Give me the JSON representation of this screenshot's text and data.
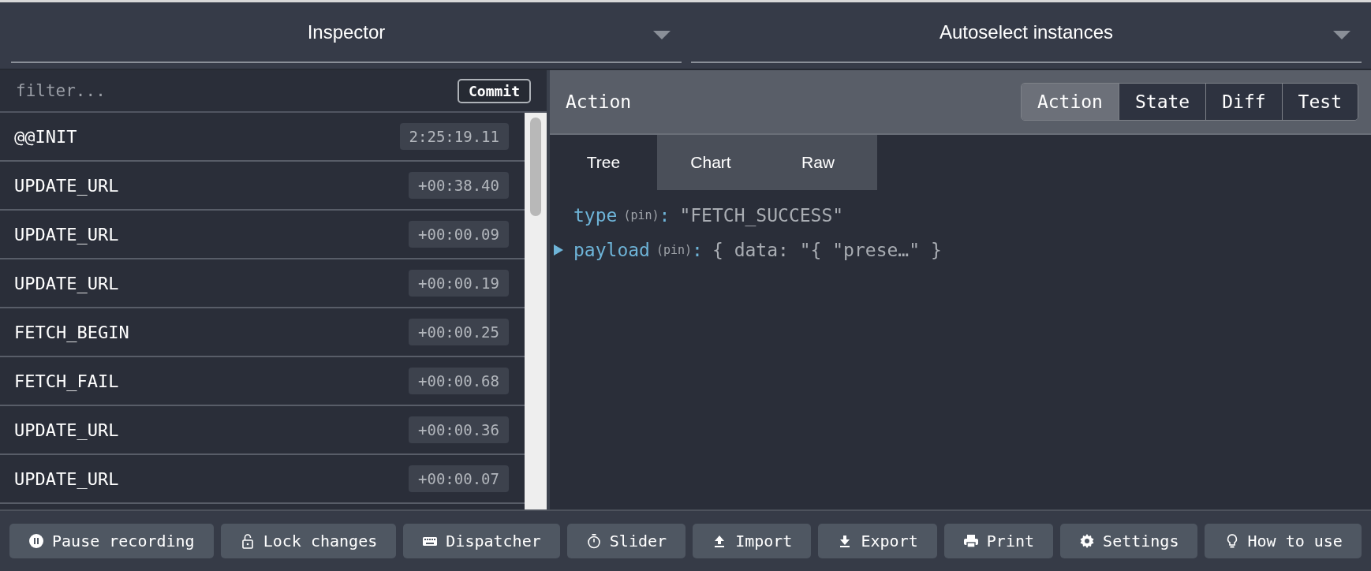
{
  "monitor_select": {
    "label": "Inspector"
  },
  "instance_select": {
    "label": "Autoselect instances"
  },
  "filter": {
    "placeholder": "filter..."
  },
  "commit_button": "Commit",
  "actions": [
    {
      "name": "@@INIT",
      "time": "2:25:19.11"
    },
    {
      "name": "UPDATE_URL",
      "time": "+00:38.40"
    },
    {
      "name": "UPDATE_URL",
      "time": "+00:00.09"
    },
    {
      "name": "UPDATE_URL",
      "time": "+00:00.19"
    },
    {
      "name": "FETCH_BEGIN",
      "time": "+00:00.25"
    },
    {
      "name": "FETCH_FAIL",
      "time": "+00:00.68"
    },
    {
      "name": "UPDATE_URL",
      "time": "+00:00.36"
    },
    {
      "name": "UPDATE_URL",
      "time": "+00:00.07"
    }
  ],
  "action_header": {
    "title": "Action"
  },
  "view_tabs": [
    {
      "label": "Action",
      "selected": true
    },
    {
      "label": "State",
      "selected": false
    },
    {
      "label": "Diff",
      "selected": false
    },
    {
      "label": "Test",
      "selected": false
    }
  ],
  "sub_tabs": [
    {
      "label": "Tree",
      "selected": true
    },
    {
      "label": "Chart",
      "selected": false
    },
    {
      "label": "Raw",
      "selected": false
    }
  ],
  "tree": [
    {
      "key": "type",
      "pin": "(pin)",
      "sep": ":",
      "value": "\"FETCH_SUCCESS\"",
      "expandable": false
    },
    {
      "key": "payload",
      "pin": "(pin)",
      "sep": ":",
      "value": "{ data: \"{ \"prese…\" }",
      "expandable": true
    }
  ],
  "toolbar": [
    "Pause recording",
    "Lock changes",
    "Dispatcher",
    "Slider",
    "Import",
    "Export",
    "Print",
    "Settings",
    "How to use"
  ]
}
